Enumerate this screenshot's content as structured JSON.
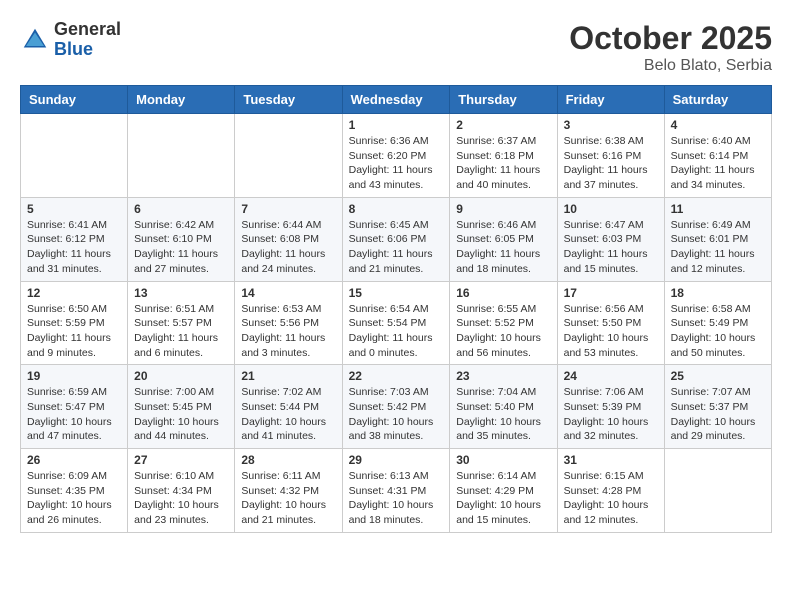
{
  "header": {
    "logo_general": "General",
    "logo_blue": "Blue",
    "month_title": "October 2025",
    "location": "Belo Blato, Serbia"
  },
  "weekdays": [
    "Sunday",
    "Monday",
    "Tuesday",
    "Wednesday",
    "Thursday",
    "Friday",
    "Saturday"
  ],
  "weeks": [
    [
      {
        "day": "",
        "info": ""
      },
      {
        "day": "",
        "info": ""
      },
      {
        "day": "",
        "info": ""
      },
      {
        "day": "1",
        "info": "Sunrise: 6:36 AM\nSunset: 6:20 PM\nDaylight: 11 hours\nand 43 minutes."
      },
      {
        "day": "2",
        "info": "Sunrise: 6:37 AM\nSunset: 6:18 PM\nDaylight: 11 hours\nand 40 minutes."
      },
      {
        "day": "3",
        "info": "Sunrise: 6:38 AM\nSunset: 6:16 PM\nDaylight: 11 hours\nand 37 minutes."
      },
      {
        "day": "4",
        "info": "Sunrise: 6:40 AM\nSunset: 6:14 PM\nDaylight: 11 hours\nand 34 minutes."
      }
    ],
    [
      {
        "day": "5",
        "info": "Sunrise: 6:41 AM\nSunset: 6:12 PM\nDaylight: 11 hours\nand 31 minutes."
      },
      {
        "day": "6",
        "info": "Sunrise: 6:42 AM\nSunset: 6:10 PM\nDaylight: 11 hours\nand 27 minutes."
      },
      {
        "day": "7",
        "info": "Sunrise: 6:44 AM\nSunset: 6:08 PM\nDaylight: 11 hours\nand 24 minutes."
      },
      {
        "day": "8",
        "info": "Sunrise: 6:45 AM\nSunset: 6:06 PM\nDaylight: 11 hours\nand 21 minutes."
      },
      {
        "day": "9",
        "info": "Sunrise: 6:46 AM\nSunset: 6:05 PM\nDaylight: 11 hours\nand 18 minutes."
      },
      {
        "day": "10",
        "info": "Sunrise: 6:47 AM\nSunset: 6:03 PM\nDaylight: 11 hours\nand 15 minutes."
      },
      {
        "day": "11",
        "info": "Sunrise: 6:49 AM\nSunset: 6:01 PM\nDaylight: 11 hours\nand 12 minutes."
      }
    ],
    [
      {
        "day": "12",
        "info": "Sunrise: 6:50 AM\nSunset: 5:59 PM\nDaylight: 11 hours\nand 9 minutes."
      },
      {
        "day": "13",
        "info": "Sunrise: 6:51 AM\nSunset: 5:57 PM\nDaylight: 11 hours\nand 6 minutes."
      },
      {
        "day": "14",
        "info": "Sunrise: 6:53 AM\nSunset: 5:56 PM\nDaylight: 11 hours\nand 3 minutes."
      },
      {
        "day": "15",
        "info": "Sunrise: 6:54 AM\nSunset: 5:54 PM\nDaylight: 11 hours\nand 0 minutes."
      },
      {
        "day": "16",
        "info": "Sunrise: 6:55 AM\nSunset: 5:52 PM\nDaylight: 10 hours\nand 56 minutes."
      },
      {
        "day": "17",
        "info": "Sunrise: 6:56 AM\nSunset: 5:50 PM\nDaylight: 10 hours\nand 53 minutes."
      },
      {
        "day": "18",
        "info": "Sunrise: 6:58 AM\nSunset: 5:49 PM\nDaylight: 10 hours\nand 50 minutes."
      }
    ],
    [
      {
        "day": "19",
        "info": "Sunrise: 6:59 AM\nSunset: 5:47 PM\nDaylight: 10 hours\nand 47 minutes."
      },
      {
        "day": "20",
        "info": "Sunrise: 7:00 AM\nSunset: 5:45 PM\nDaylight: 10 hours\nand 44 minutes."
      },
      {
        "day": "21",
        "info": "Sunrise: 7:02 AM\nSunset: 5:44 PM\nDaylight: 10 hours\nand 41 minutes."
      },
      {
        "day": "22",
        "info": "Sunrise: 7:03 AM\nSunset: 5:42 PM\nDaylight: 10 hours\nand 38 minutes."
      },
      {
        "day": "23",
        "info": "Sunrise: 7:04 AM\nSunset: 5:40 PM\nDaylight: 10 hours\nand 35 minutes."
      },
      {
        "day": "24",
        "info": "Sunrise: 7:06 AM\nSunset: 5:39 PM\nDaylight: 10 hours\nand 32 minutes."
      },
      {
        "day": "25",
        "info": "Sunrise: 7:07 AM\nSunset: 5:37 PM\nDaylight: 10 hours\nand 29 minutes."
      }
    ],
    [
      {
        "day": "26",
        "info": "Sunrise: 6:09 AM\nSunset: 4:35 PM\nDaylight: 10 hours\nand 26 minutes."
      },
      {
        "day": "27",
        "info": "Sunrise: 6:10 AM\nSunset: 4:34 PM\nDaylight: 10 hours\nand 23 minutes."
      },
      {
        "day": "28",
        "info": "Sunrise: 6:11 AM\nSunset: 4:32 PM\nDaylight: 10 hours\nand 21 minutes."
      },
      {
        "day": "29",
        "info": "Sunrise: 6:13 AM\nSunset: 4:31 PM\nDaylight: 10 hours\nand 18 minutes."
      },
      {
        "day": "30",
        "info": "Sunrise: 6:14 AM\nSunset: 4:29 PM\nDaylight: 10 hours\nand 15 minutes."
      },
      {
        "day": "31",
        "info": "Sunrise: 6:15 AM\nSunset: 4:28 PM\nDaylight: 10 hours\nand 12 minutes."
      },
      {
        "day": "",
        "info": ""
      }
    ]
  ]
}
